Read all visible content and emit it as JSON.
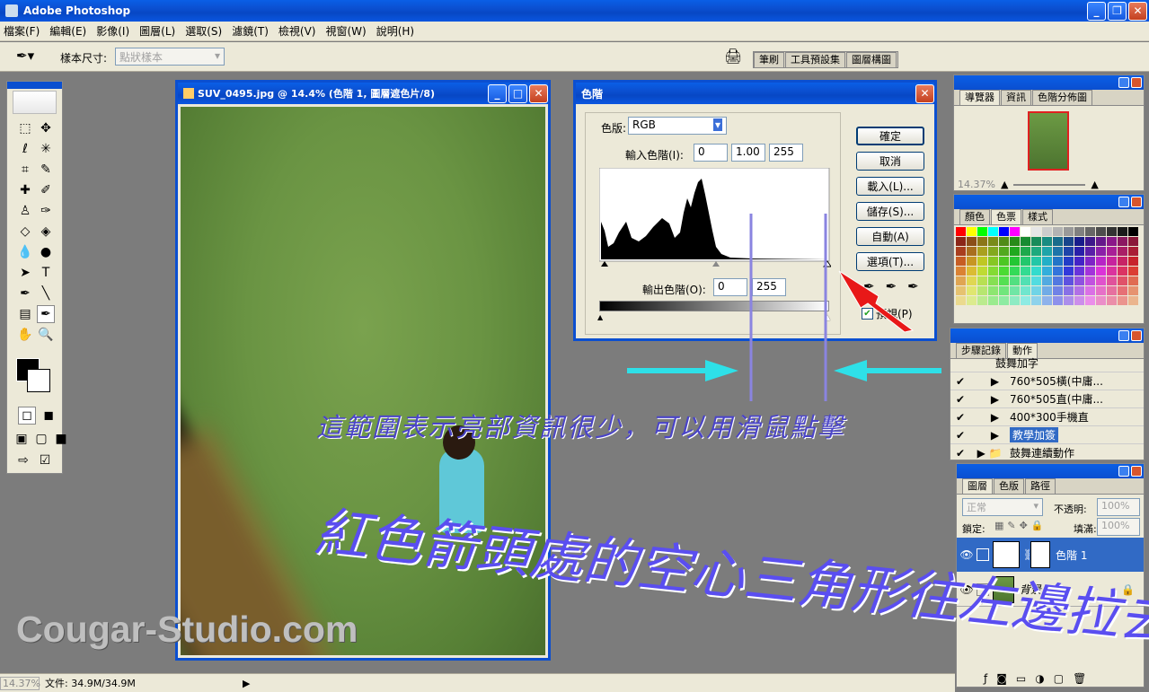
{
  "app": {
    "title": "Adobe Photoshop"
  },
  "menu": [
    "檔案(F)",
    "編輯(E)",
    "影像(I)",
    "圖層(L)",
    "選取(S)",
    "濾鏡(T)",
    "檢視(V)",
    "視窗(W)",
    "說明(H)"
  ],
  "options": {
    "sample_label": "樣本尺寸:",
    "sample_value": "點狀樣本",
    "wells": [
      "筆刷",
      "工具預設集",
      "圖層構圖"
    ]
  },
  "document": {
    "title": "SUV_0495.jpg @ 14.4% (色階 1, 圖層遮色片/8)"
  },
  "levels": {
    "title": "色階",
    "channel_label": "色版:",
    "channel_value": "RGB",
    "input_label": "輸入色階(I):",
    "input_values": [
      "0",
      "1.00",
      "255"
    ],
    "output_label": "輸出色階(O):",
    "output_values": [
      "0",
      "255"
    ],
    "buttons": [
      "確定",
      "取消",
      "載入(L)...",
      "儲存(S)...",
      "自動(A)",
      "選項(T)..."
    ],
    "preview_label": "預視(P)"
  },
  "navigator": {
    "tabs": [
      "導覽器",
      "資訊",
      "色階分佈圖"
    ],
    "zoom": "14.37%"
  },
  "color": {
    "tabs": [
      "顏色",
      "色票",
      "樣式"
    ]
  },
  "actions": {
    "tabs": [
      "步驟記錄",
      "動作"
    ],
    "items": [
      "鼓舞加字",
      "760*505橫(中庸...",
      "760*505直(中庸...",
      "400*300手機直",
      "教學加簽",
      "鼓舞連續動作"
    ]
  },
  "layers": {
    "tabs": [
      "圖層",
      "色版",
      "路徑"
    ],
    "blend": "正常",
    "opacity_label": "不透明:",
    "opacity": "100%",
    "lock_label": "鎖定:",
    "fill_label": "填滿:",
    "fill": "100%",
    "items": [
      "色階 1",
      "背景"
    ]
  },
  "status": {
    "zoom": "14.37%",
    "doc": "文件: 34.9M/34.9M"
  },
  "annotations": {
    "line1": "這範圍表示亮部資訊很少，可以用滑鼠點擊",
    "line2": "紅色箭頭處的空心三角形往左邊拉去",
    "watermark": "Cougar-Studio.com"
  },
  "swatch_colors": [
    "#ff0000",
    "#ffff00",
    "#00ff00",
    "#00ffff",
    "#0000ff",
    "#ff00ff",
    "#ffffff",
    "#e6e6e6",
    "#cccccc",
    "#b3b3b3",
    "#999999",
    "#808080",
    "#666666",
    "#4d4d4d",
    "#333333",
    "#1a1a1a",
    "#000000"
  ]
}
